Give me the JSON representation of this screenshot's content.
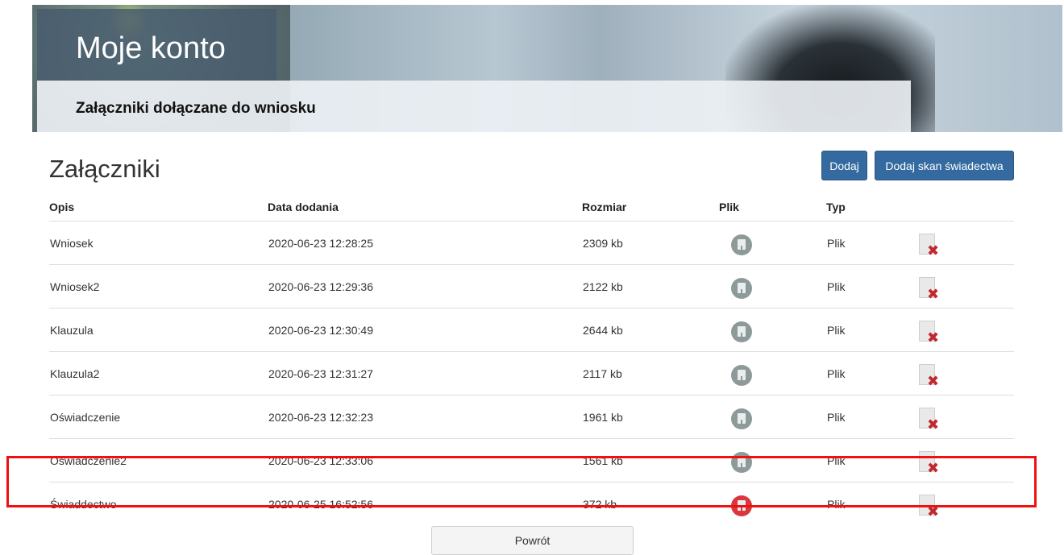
{
  "header": {
    "title": "Moje konto",
    "subtitle": "Załączniki dołączane do wniosku"
  },
  "section": {
    "title": "Załączniki",
    "add_label": "Dodaj",
    "add_scan_label": "Dodaj skan świadectwa"
  },
  "table": {
    "columns": [
      "Opis",
      "Data dodania",
      "Rozmiar",
      "Plik",
      "Typ"
    ],
    "rows": [
      {
        "opis": "Wniosek",
        "data": "2020-06-23 12:28:25",
        "rozmiar": "2309 kb",
        "typ": "Plik"
      },
      {
        "opis": "Wniosek2",
        "data": "2020-06-23 12:29:36",
        "rozmiar": "2122 kb",
        "typ": "Plik"
      },
      {
        "opis": "Klauzula",
        "data": "2020-06-23 12:30:49",
        "rozmiar": "2644 kb",
        "typ": "Plik"
      },
      {
        "opis": "Klauzula2",
        "data": "2020-06-23 12:31:27",
        "rozmiar": "2117 kb",
        "typ": "Plik"
      },
      {
        "opis": "Oświadczenie",
        "data": "2020-06-23 12:32:23",
        "rozmiar": "1961 kb",
        "typ": "Plik"
      },
      {
        "opis": "Oświadczenie2",
        "data": "2020-06-23 12:33:06",
        "rozmiar": "1561 kb",
        "typ": "Plik"
      },
      {
        "opis": "Świaddectwo",
        "data": "2020-06-25 16:52:56",
        "rozmiar": "372 kb",
        "typ": "Plik"
      }
    ]
  },
  "footer": {
    "back_label": "Powrót"
  },
  "colors": {
    "primary_button": "#346aa0",
    "highlight_border": "#ee1111",
    "file_icon": "#8d9a99",
    "file_icon_highlight": "#d9363e",
    "delete_x": "#c0282d"
  },
  "icons": {
    "file": "download-file-icon",
    "delete": "delete-document-icon"
  }
}
